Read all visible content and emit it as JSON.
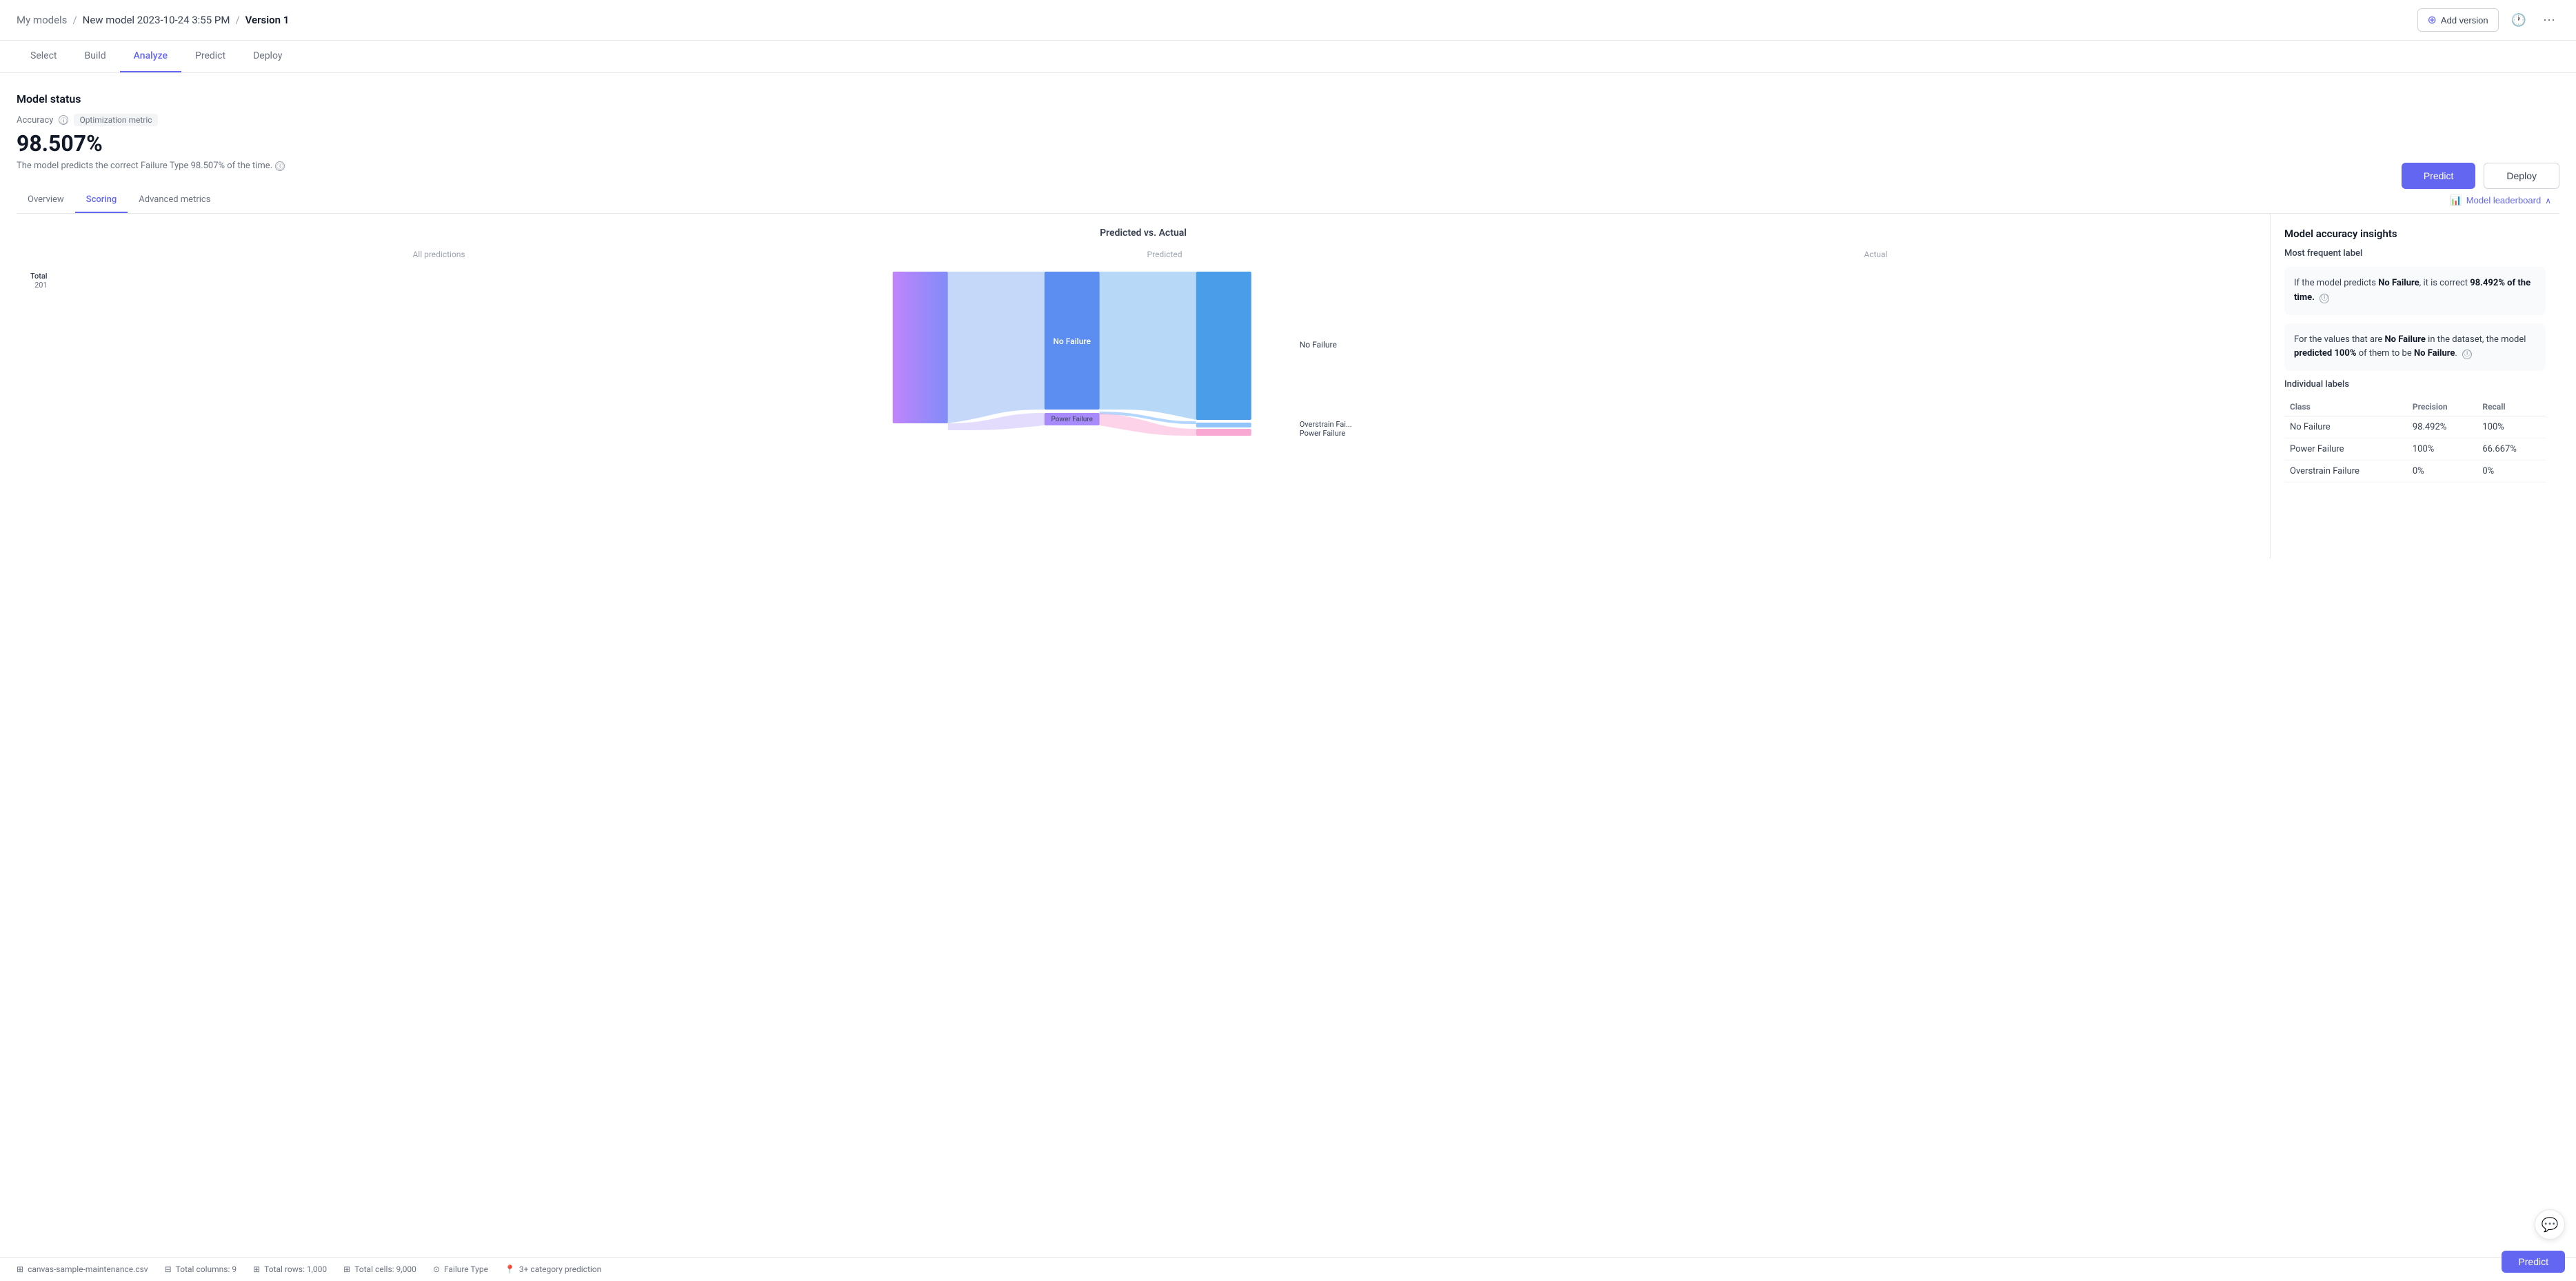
{
  "header": {
    "breadcrumb": "My models / New model 2023-10-24 3:55 PM / Version 1",
    "my_models": "My models",
    "separator1": "/",
    "model_name": "New model 2023-10-24 3:55 PM",
    "separator2": "/",
    "version": "Version 1",
    "add_version_label": "Add version"
  },
  "nav_tabs": [
    {
      "id": "select",
      "label": "Select"
    },
    {
      "id": "build",
      "label": "Build"
    },
    {
      "id": "analyze",
      "label": "Analyze",
      "active": true
    },
    {
      "id": "predict",
      "label": "Predict"
    },
    {
      "id": "deploy",
      "label": "Deploy"
    }
  ],
  "model_status": {
    "title": "Model status",
    "accuracy_label": "Accuracy",
    "opt_metric": "Optimization metric",
    "accuracy_value": "98.507%",
    "accuracy_desc": "The model predicts the correct Failure Type 98.507% of the time."
  },
  "action_buttons": {
    "predict": "Predict",
    "deploy": "Deploy"
  },
  "sub_tabs": [
    {
      "id": "overview",
      "label": "Overview"
    },
    {
      "id": "scoring",
      "label": "Scoring",
      "active": true
    },
    {
      "id": "advanced",
      "label": "Advanced metrics"
    }
  ],
  "model_leaderboard": "Model leaderboard",
  "chart": {
    "title": "Predicted vs. Actual",
    "label_all": "All predictions",
    "label_predicted": "Predicted",
    "label_actual": "Actual",
    "y_label": "Total",
    "y_value": "201",
    "nodes": {
      "all_predictions": "All predictions",
      "no_failure_predicted": "No Failure",
      "power_failure_predicted": "Power Failure",
      "no_failure_actual": "No Failure",
      "overstrain_actual": "Overstrain Fai...",
      "power_actual": "Power Failure"
    }
  },
  "right_panel": {
    "title": "Model accuracy insights",
    "subtitle": "Most frequent label",
    "insight1": "If the model predicts No Failure, it is correct 98.492% of the time.",
    "insight1_strong": "No Failure",
    "insight1_pct": "98.492%",
    "insight2_label1": "No Failure",
    "insight2_pct": "100%",
    "insight2_label2": "No Failure",
    "individual_labels_title": "Individual labels",
    "table": {
      "headers": [
        "Class",
        "Precision",
        "Recall"
      ],
      "rows": [
        {
          "class": "No Failure",
          "precision": "98.492%",
          "recall": "100%"
        },
        {
          "class": "Power Failure",
          "precision": "100%",
          "recall": "66.667%"
        },
        {
          "class": "Overstrain Failure",
          "precision": "0%",
          "recall": "0%"
        }
      ]
    }
  },
  "footer": {
    "file": "canvas-sample-maintenance.csv",
    "columns": "Total columns: 9",
    "rows": "Total rows: 1,000",
    "cells": "Total cells: 9,000",
    "target": "Failure Type",
    "prediction_type": "3+ category prediction",
    "predict_btn": "Predict"
  }
}
